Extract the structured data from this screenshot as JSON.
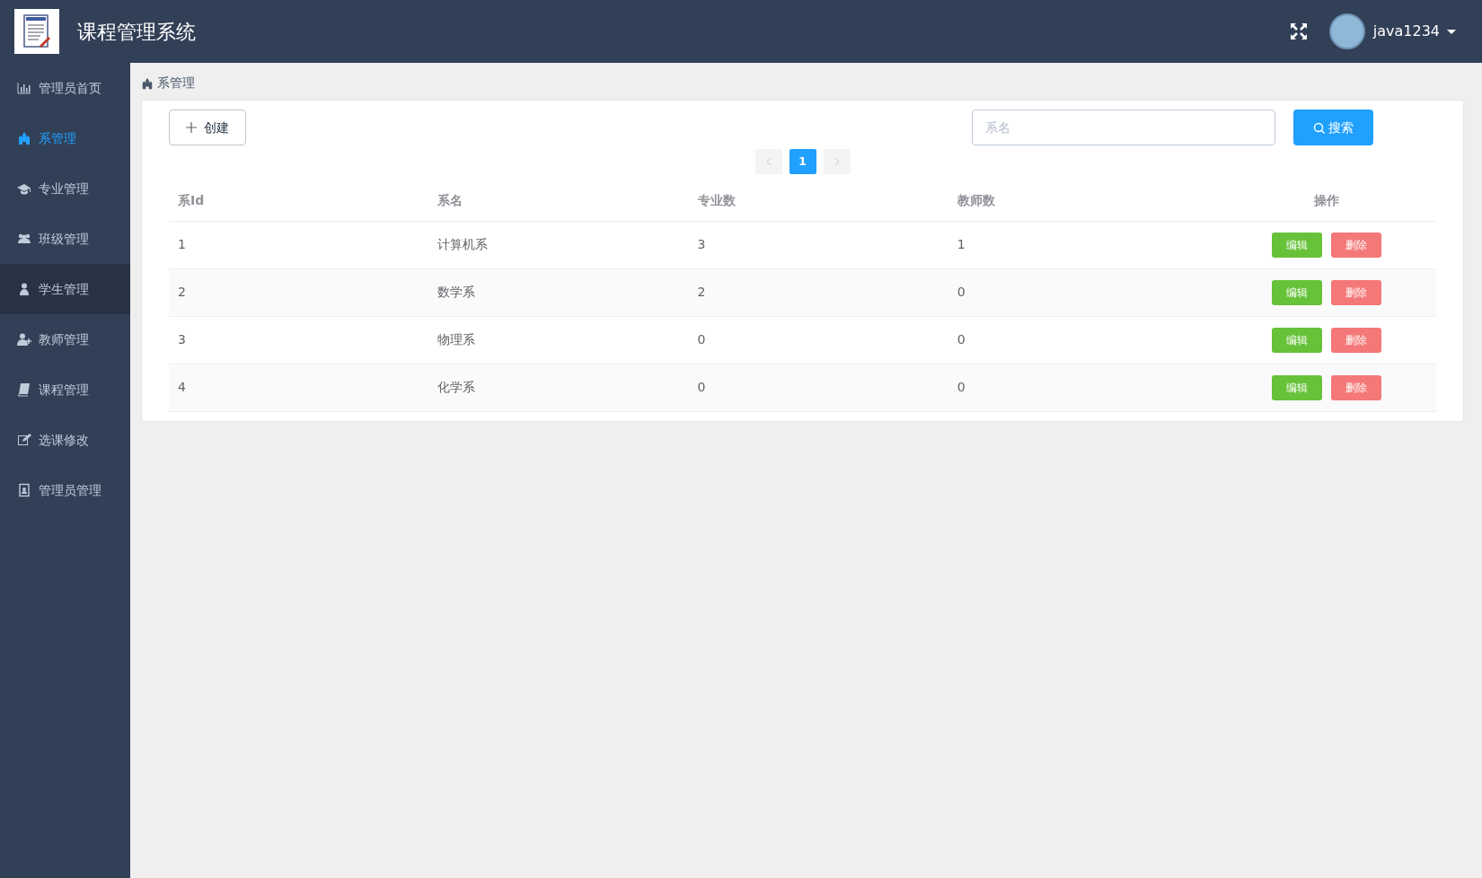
{
  "header": {
    "title": "课程管理系统",
    "user": "java1234"
  },
  "sidebar": {
    "items": [
      {
        "label": "管理员首页",
        "selected": false,
        "highlighted": false
      },
      {
        "label": "系管理",
        "selected": true,
        "highlighted": false
      },
      {
        "label": "专业管理",
        "selected": false,
        "highlighted": false
      },
      {
        "label": "班级管理",
        "selected": false,
        "highlighted": false
      },
      {
        "label": "学生管理",
        "selected": false,
        "highlighted": true
      },
      {
        "label": "教师管理",
        "selected": false,
        "highlighted": false
      },
      {
        "label": "课程管理",
        "selected": false,
        "highlighted": false
      },
      {
        "label": "选课修改",
        "selected": false,
        "highlighted": false
      },
      {
        "label": "管理员管理",
        "selected": false,
        "highlighted": false
      }
    ]
  },
  "breadcrumb": "系管理",
  "toolbar": {
    "create": "创建",
    "search": {
      "placeholder": "系名"
    },
    "search_button": "搜索"
  },
  "pagination": {
    "pages": [
      {
        "label": "1",
        "selected": true
      }
    ]
  },
  "table": {
    "columns": [
      "系Id",
      "系名",
      "专业数",
      "教师数",
      "操作"
    ],
    "rows": [
      {
        "cells": [
          "1",
          "计算机系",
          "3",
          "1"
        ],
        "actions": [
          "编辑",
          "删除"
        ]
      },
      {
        "cells": [
          "2",
          "数学系",
          "2",
          "0"
        ],
        "actions": [
          "编辑",
          "删除"
        ]
      },
      {
        "cells": [
          "3",
          "物理系",
          "0",
          "0"
        ],
        "actions": [
          "编辑",
          "删除"
        ]
      },
      {
        "cells": [
          "4",
          "化学系",
          "0",
          "0"
        ],
        "actions": [
          "编辑",
          "删除"
        ]
      }
    ]
  }
}
